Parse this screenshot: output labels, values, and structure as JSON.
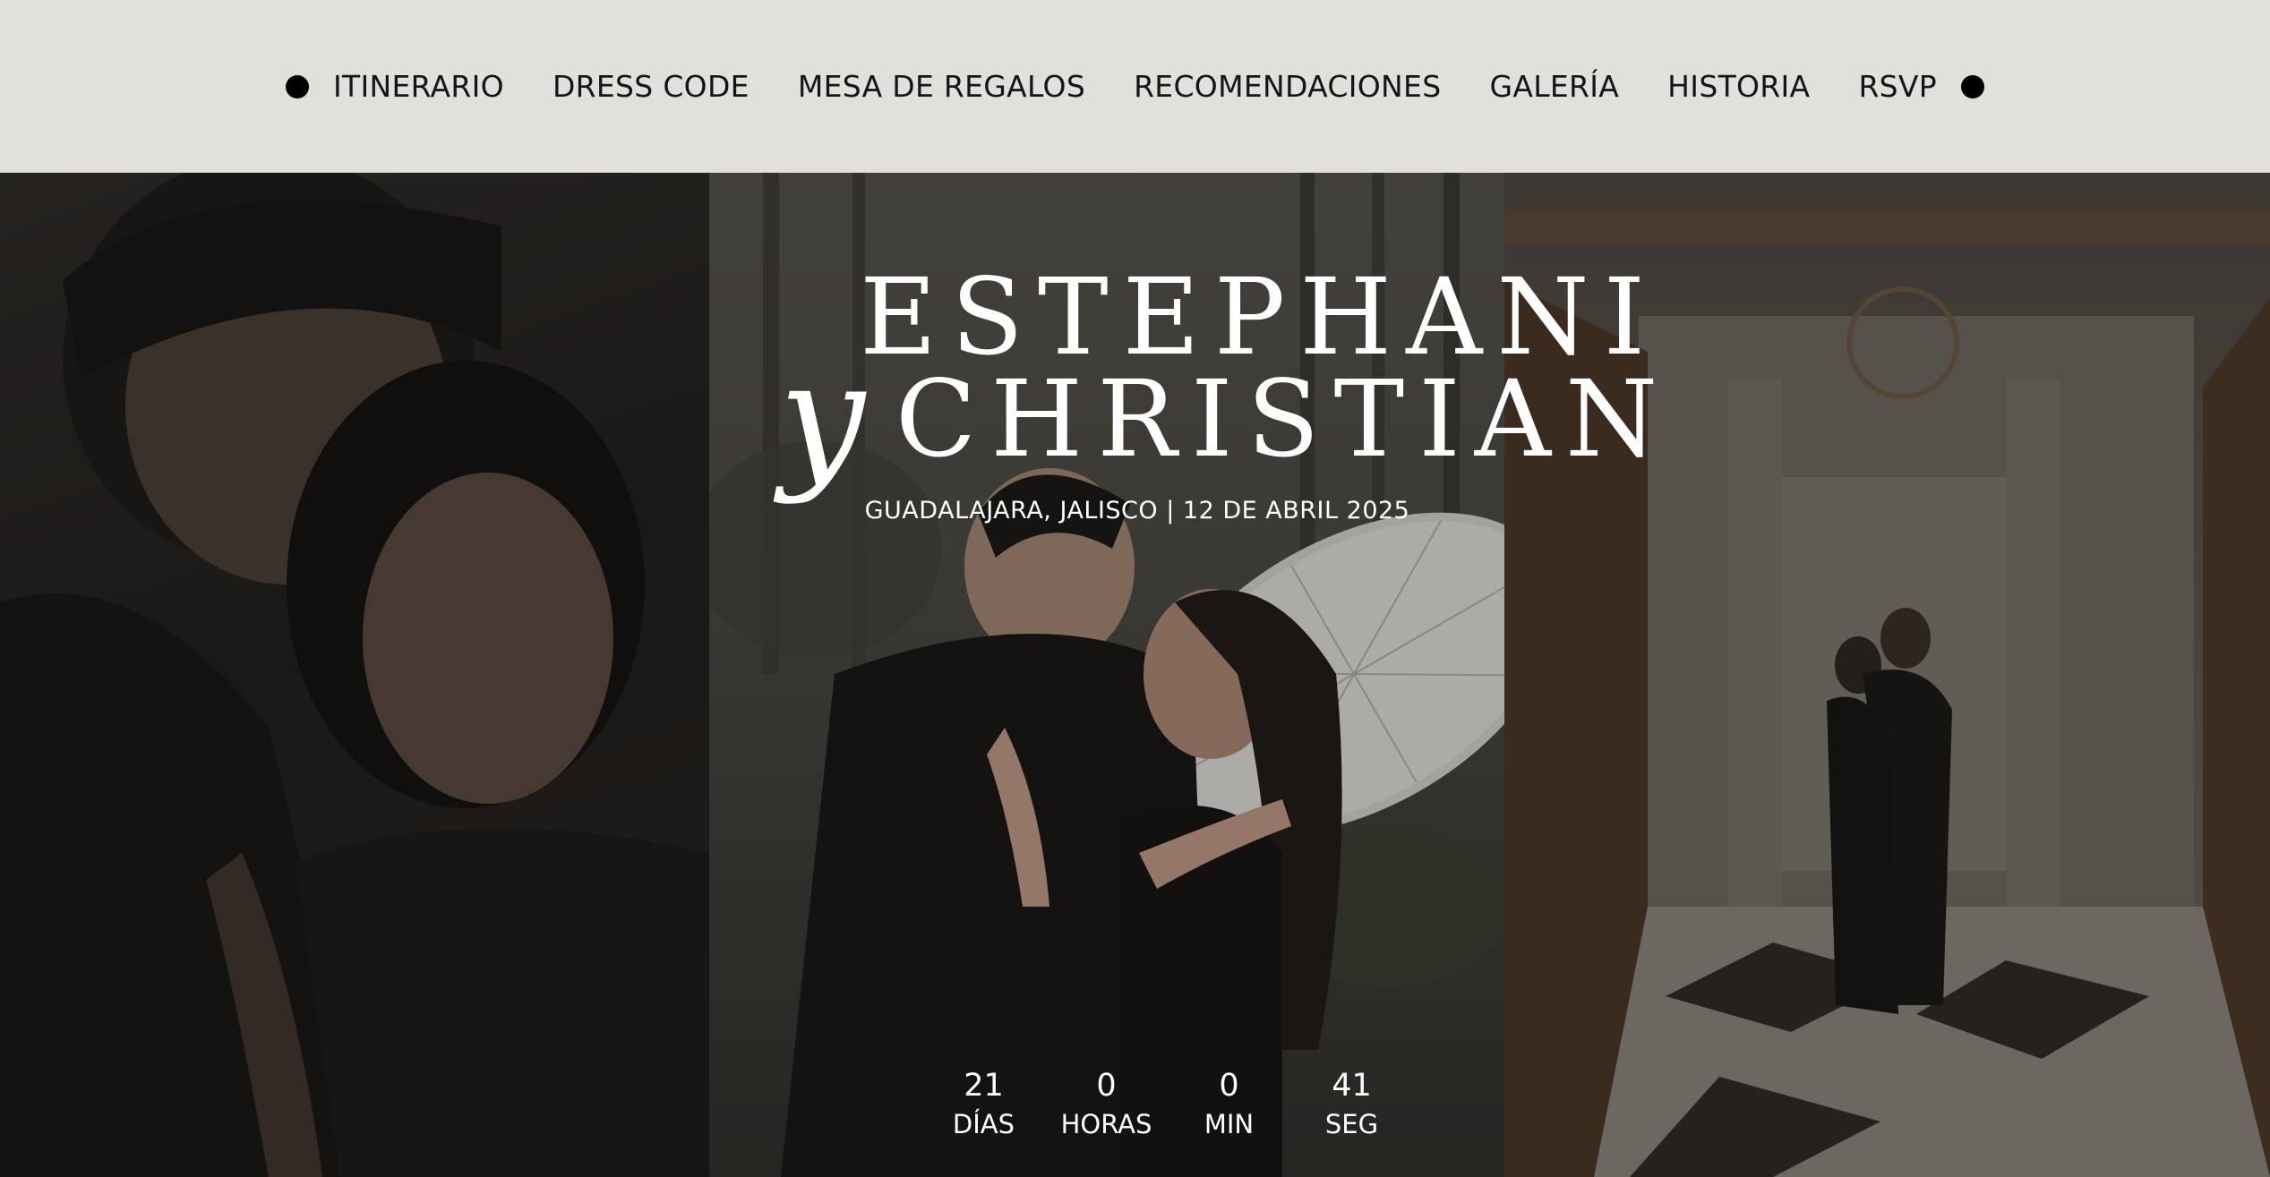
{
  "nav": {
    "items": [
      {
        "label": "ITINERARIO"
      },
      {
        "label": "DRESS CODE"
      },
      {
        "label": "MESA DE REGALOS"
      },
      {
        "label": "RECOMENDACIONES"
      },
      {
        "label": "GALERÍA"
      },
      {
        "label": "HISTORIA"
      },
      {
        "label": "RSVP"
      }
    ]
  },
  "hero": {
    "name_first": "ESTEPHANI",
    "connector": "y",
    "name_second": "CHRISTIAN",
    "location": "GUADALAJARA, JALISCO | 12 DE ABRIL 2025",
    "countdown": [
      {
        "value": "21",
        "label": "DÍAS"
      },
      {
        "value": "0",
        "label": "HORAS"
      },
      {
        "value": "0",
        "label": "MIN"
      },
      {
        "value": "41",
        "label": "SEG"
      }
    ],
    "photos": [
      {
        "icon": "couple-closeup-photo"
      },
      {
        "icon": "couple-umbrella-photo"
      },
      {
        "icon": "couple-hall-photo"
      }
    ]
  },
  "colors": {
    "nav_bg": "#e2e0dd",
    "nav_text": "#151515",
    "hero_text": "#ffffff"
  }
}
